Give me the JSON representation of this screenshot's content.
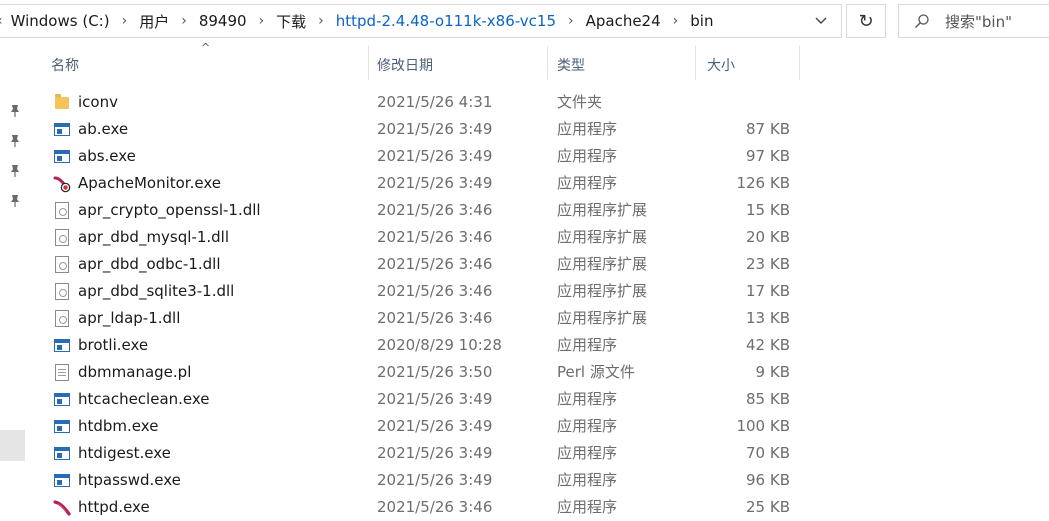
{
  "address": {
    "lead": "‹",
    "crumbs": [
      "Windows (C:)",
      "用户",
      "89490",
      "下载",
      "httpd-2.4.48-o111k-x86-vc15",
      "Apache24",
      "bin"
    ],
    "separator": "›",
    "dropdown": "⌄",
    "refresh": "↻"
  },
  "search": {
    "placeholder": "搜索\"bin\""
  },
  "columns": {
    "name": "名称",
    "date": "修改日期",
    "type": "类型",
    "size": "大小",
    "sort_arrow": "^"
  },
  "files": [
    {
      "icon": "folder-icon",
      "name": "iconv",
      "date": "2021/5/26 4:31",
      "type": "文件夹",
      "size": ""
    },
    {
      "icon": "exe-icon",
      "name": "ab.exe",
      "date": "2021/5/26 3:49",
      "type": "应用程序",
      "size": "87 KB"
    },
    {
      "icon": "exe-icon",
      "name": "abs.exe",
      "date": "2021/5/26 3:49",
      "type": "应用程序",
      "size": "97 KB"
    },
    {
      "icon": "apache-monitor-icon",
      "name": "ApacheMonitor.exe",
      "date": "2021/5/26 3:49",
      "type": "应用程序",
      "size": "126 KB"
    },
    {
      "icon": "dll-icon",
      "name": "apr_crypto_openssl-1.dll",
      "date": "2021/5/26 3:46",
      "type": "应用程序扩展",
      "size": "15 KB"
    },
    {
      "icon": "dll-icon",
      "name": "apr_dbd_mysql-1.dll",
      "date": "2021/5/26 3:46",
      "type": "应用程序扩展",
      "size": "20 KB"
    },
    {
      "icon": "dll-icon",
      "name": "apr_dbd_odbc-1.dll",
      "date": "2021/5/26 3:46",
      "type": "应用程序扩展",
      "size": "23 KB"
    },
    {
      "icon": "dll-icon",
      "name": "apr_dbd_sqlite3-1.dll",
      "date": "2021/5/26 3:46",
      "type": "应用程序扩展",
      "size": "17 KB"
    },
    {
      "icon": "dll-icon",
      "name": "apr_ldap-1.dll",
      "date": "2021/5/26 3:46",
      "type": "应用程序扩展",
      "size": "13 KB"
    },
    {
      "icon": "exe-icon",
      "name": "brotli.exe",
      "date": "2020/8/29 10:28",
      "type": "应用程序",
      "size": "42 KB"
    },
    {
      "icon": "perl-file-icon",
      "name": "dbmmanage.pl",
      "date": "2021/5/26 3:50",
      "type": "Perl 源文件",
      "size": "9 KB"
    },
    {
      "icon": "exe-icon",
      "name": "htcacheclean.exe",
      "date": "2021/5/26 3:49",
      "type": "应用程序",
      "size": "85 KB"
    },
    {
      "icon": "exe-icon",
      "name": "htdbm.exe",
      "date": "2021/5/26 3:49",
      "type": "应用程序",
      "size": "100 KB"
    },
    {
      "icon": "exe-icon",
      "name": "htdigest.exe",
      "date": "2021/5/26 3:49",
      "type": "应用程序",
      "size": "70 KB"
    },
    {
      "icon": "exe-icon",
      "name": "htpasswd.exe",
      "date": "2021/5/26 3:49",
      "type": "应用程序",
      "size": "96 KB"
    },
    {
      "icon": "apache-feather-icon",
      "name": "httpd.exe",
      "date": "2021/5/26 3:46",
      "type": "应用程序",
      "size": "25 KB"
    }
  ],
  "colors": {
    "header_text": "#4c607a",
    "secondary_text": "#6d6d6d",
    "folder": "#f2c55c",
    "exe_blue": "#2b6bb3",
    "feather": "#b3205a"
  }
}
